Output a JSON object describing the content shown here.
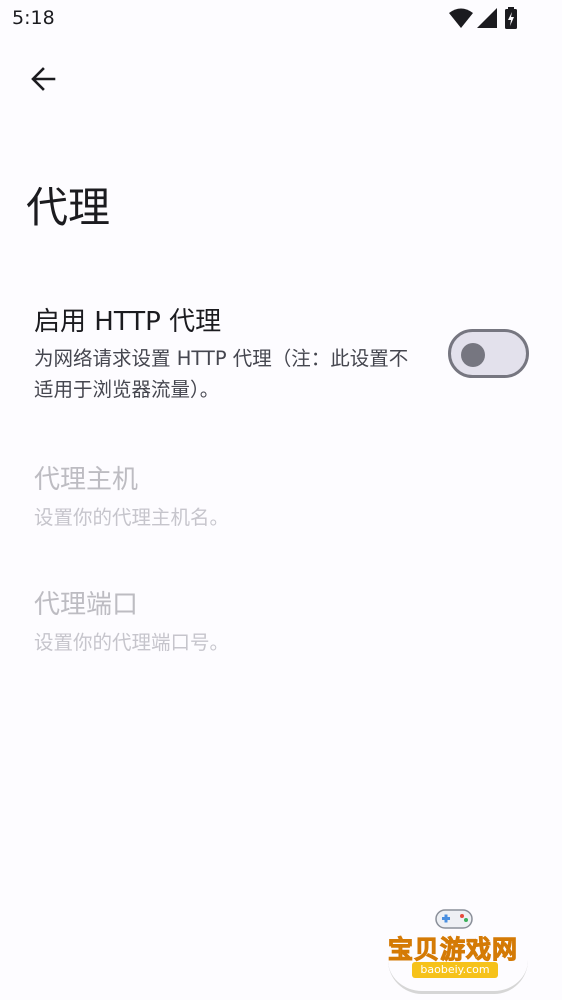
{
  "status_bar": {
    "time": "5:18",
    "icons": [
      "wifi-icon",
      "signal-icon",
      "battery-charging-icon"
    ]
  },
  "toolbar": {
    "back_icon": "arrow-back-icon"
  },
  "page": {
    "title": "代理"
  },
  "preferences": {
    "http_proxy": {
      "title": "启用 HTTP 代理",
      "summary": "为网络请求设置 HTTP 代理（注：此设置不适用于浏览器流量）。",
      "enabled": false
    },
    "proxy_host": {
      "title": "代理主机",
      "summary": "设置你的代理主机名。"
    },
    "proxy_port": {
      "title": "代理端口",
      "summary": "设置你的代理端口号。"
    }
  },
  "watermark": {
    "text": "宝贝游戏网",
    "url": "baobeiy.com"
  },
  "colors": {
    "background": "#fdfcff",
    "text_primary": "#1b1b1f",
    "text_disabled": "#bdbcc2",
    "switch_off": "#767680",
    "switch_track": "#e3e1ec"
  }
}
